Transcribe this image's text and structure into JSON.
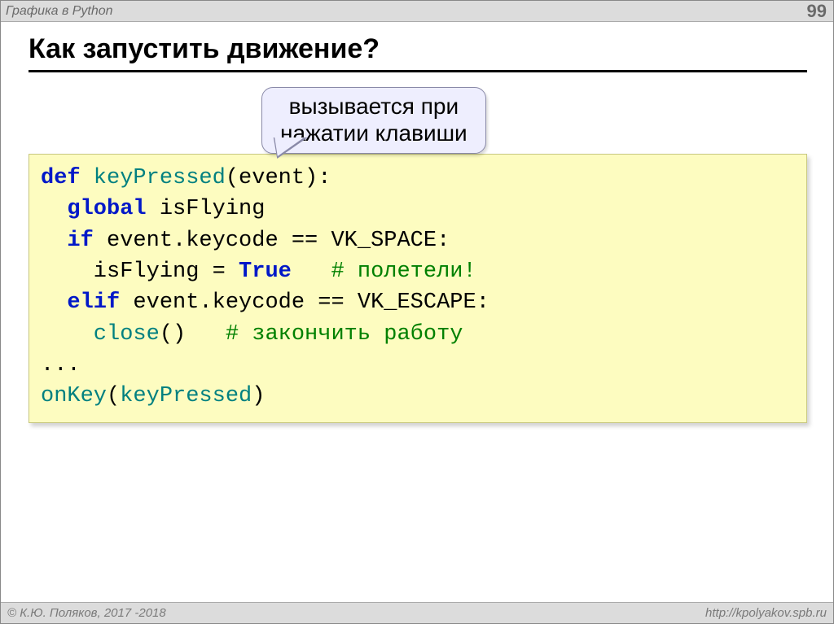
{
  "header": {
    "title": "Графика в Python",
    "page": "99"
  },
  "slide_title": "Как запустить движение?",
  "callout": {
    "line1": "вызывается при",
    "line2": "нажатии клавиши"
  },
  "code": {
    "l1_def": "def",
    "l1_fn": " keyPressed",
    "l1_rest": "(event):",
    "l2_kw": "  global",
    "l2_rest": " isFlying",
    "l3_kw": "  if",
    "l3_rest": " event.keycode == VK_SPACE:",
    "l4_a": "    isFlying = ",
    "l4_true": "True",
    "l4_sp": "   ",
    "l4_c": "# полетели!",
    "l5_kw": "  elif",
    "l5_rest": " event.keycode == VK_ESCAPE:",
    "l6_fn": "    close",
    "l6_paren": "()   ",
    "l6_c": "# закончить работу",
    "l7": "...",
    "l8_fn": "onKey",
    "l8_p1": "(",
    "l8_arg": "keyPressed",
    "l8_p2": ")"
  },
  "footer": {
    "left": "© К.Ю. Поляков, 2017 -2018",
    "right": "http://kpolyakov.spb.ru"
  }
}
